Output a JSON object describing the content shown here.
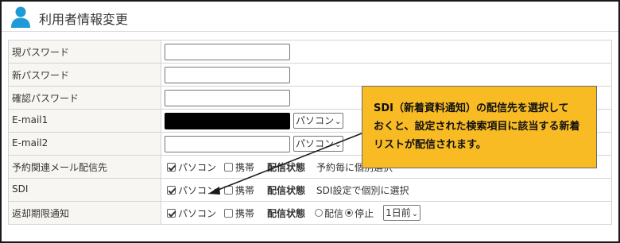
{
  "header": {
    "title": "利用者情報変更",
    "icon": "user-icon",
    "icon_color": "#1e9ad6"
  },
  "form": {
    "current_password": {
      "label": "現パスワード",
      "value": ""
    },
    "new_password": {
      "label": "新パスワード",
      "value": ""
    },
    "confirm_password": {
      "label": "確認パスワード",
      "value": ""
    },
    "email1": {
      "label": "E-mail1",
      "value": "",
      "device": "パソコン"
    },
    "email2": {
      "label": "E-mail2",
      "value": "",
      "device": "パソコン"
    },
    "reservation_mail": {
      "label": "予約関連メール配信先",
      "option_pc": "パソコン",
      "option_mobile": "携帯",
      "pc_checked": true,
      "mobile_checked": false,
      "status_label": "配信状態",
      "status_text": "予約毎に個別選択"
    },
    "sdi": {
      "label": "SDI",
      "option_pc": "パソコン",
      "option_mobile": "携帯",
      "pc_checked": true,
      "mobile_checked": false,
      "status_label": "配信状態",
      "status_text": "SDI設定で個別に選択"
    },
    "return_notice": {
      "label": "返却期限通知",
      "option_pc": "パソコン",
      "option_mobile": "携帯",
      "pc_checked": true,
      "mobile_checked": false,
      "status_label": "配信状態",
      "radio_on": "配信",
      "radio_off": "停止",
      "selected_radio": "停止",
      "days_before": "1日前"
    }
  },
  "callout": {
    "lines": [
      "SDI（新着資料通知）の配信先を選択して",
      "おくと、設定された検索項目に該当する新着",
      "リストが配信されます。"
    ],
    "background": "#f8bb24"
  }
}
